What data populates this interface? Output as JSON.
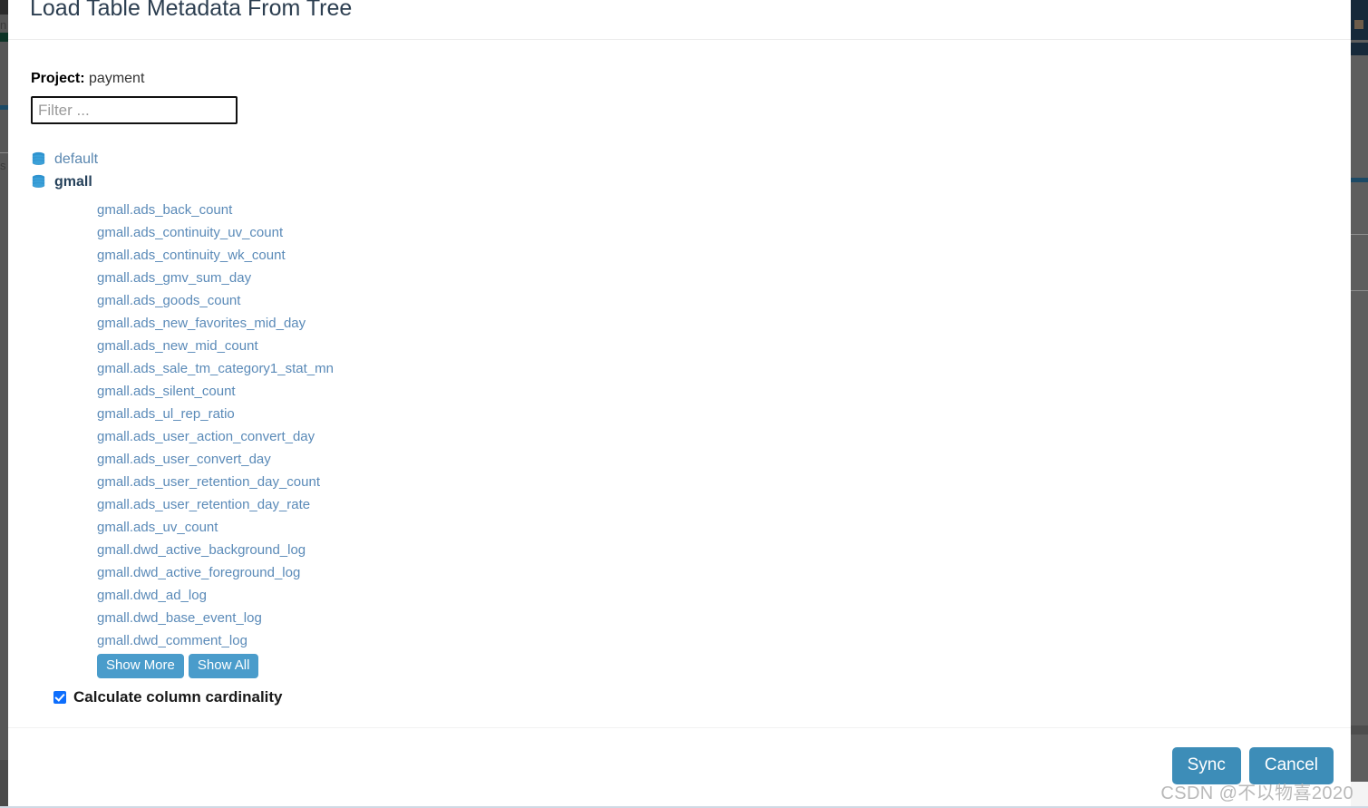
{
  "modal": {
    "title": "Load Table Metadata From Tree",
    "project_label": "Project:",
    "project_value": "payment",
    "filter_placeholder": "Filter ...",
    "filter_value": ""
  },
  "tree": {
    "databases": [
      {
        "name": "default",
        "icon": "database-icon",
        "selected": false
      },
      {
        "name": "gmall",
        "icon": "database-icon",
        "selected": true
      }
    ],
    "tables": [
      "gmall.ads_back_count",
      "gmall.ads_continuity_uv_count",
      "gmall.ads_continuity_wk_count",
      "gmall.ads_gmv_sum_day",
      "gmall.ads_goods_count",
      "gmall.ads_new_favorites_mid_day",
      "gmall.ads_new_mid_count",
      "gmall.ads_sale_tm_category1_stat_mn",
      "gmall.ads_silent_count",
      "gmall.ads_ul_rep_ratio",
      "gmall.ads_user_action_convert_day",
      "gmall.ads_user_convert_day",
      "gmall.ads_user_retention_day_count",
      "gmall.ads_user_retention_day_rate",
      "gmall.ads_uv_count",
      "gmall.dwd_active_background_log",
      "gmall.dwd_active_foreground_log",
      "gmall.dwd_ad_log",
      "gmall.dwd_base_event_log",
      "gmall.dwd_comment_log"
    ],
    "show_more_label": "Show More",
    "show_all_label": "Show All"
  },
  "options": {
    "cardinality_label": "Calculate column cardinality",
    "cardinality_checked": true
  },
  "footer": {
    "sync_label": "Sync",
    "cancel_label": "Cancel"
  },
  "watermark": {
    "text": "CSDN @不以物喜2020"
  },
  "backdrop": {
    "left_glyph_1": "n",
    "left_glyph_2": "s"
  },
  "colors": {
    "accent_blue": "#4a9ccb",
    "footer_blue": "#3d8db8",
    "link_blue": "#5a8ab8",
    "db_icon_blue": "#2a8ac4",
    "checkbox_blue": "#0d6efd",
    "title_text": "#2c3e50"
  }
}
